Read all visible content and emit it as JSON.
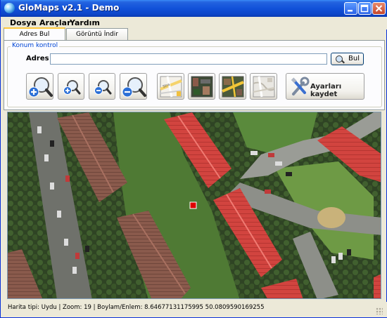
{
  "window": {
    "title": "GloMaps v2.1 - Demo"
  },
  "menu": {
    "items": [
      {
        "label": "Dosya"
      },
      {
        "label": "Araçlar"
      },
      {
        "label": "Yardım"
      }
    ]
  },
  "tabs": [
    {
      "label": "Adres Bul",
      "active": true
    },
    {
      "label": "Görüntü İndir",
      "active": false
    }
  ],
  "konum": {
    "group_title": "Konum kontrol",
    "adres_label": "Adres :",
    "adres_value": "",
    "bul_label": "Bul"
  },
  "toolbar": {
    "buttons": [
      {
        "icon": "zoom-in-large-icon"
      },
      {
        "icon": "zoom-in-small-icon"
      },
      {
        "icon": "zoom-out-small-icon"
      },
      {
        "icon": "zoom-out-large-icon"
      },
      {
        "icon": "street-map-icon"
      },
      {
        "icon": "satellite-map-icon"
      },
      {
        "icon": "hybrid-map-icon"
      },
      {
        "icon": "terrain-map-icon"
      }
    ],
    "save_label": "Ayarları kaydet"
  },
  "status": {
    "text": "Harita tipi: Uydu  |  Zoom: 19  |  Boylam/Enlem: 8.64677131175995 50.0809590169255"
  },
  "colors": {
    "title_blue": "#0d45c8",
    "roof_red": "#d2423f",
    "grass_green": "#5f8a3a",
    "marker_red": "#e00000"
  }
}
